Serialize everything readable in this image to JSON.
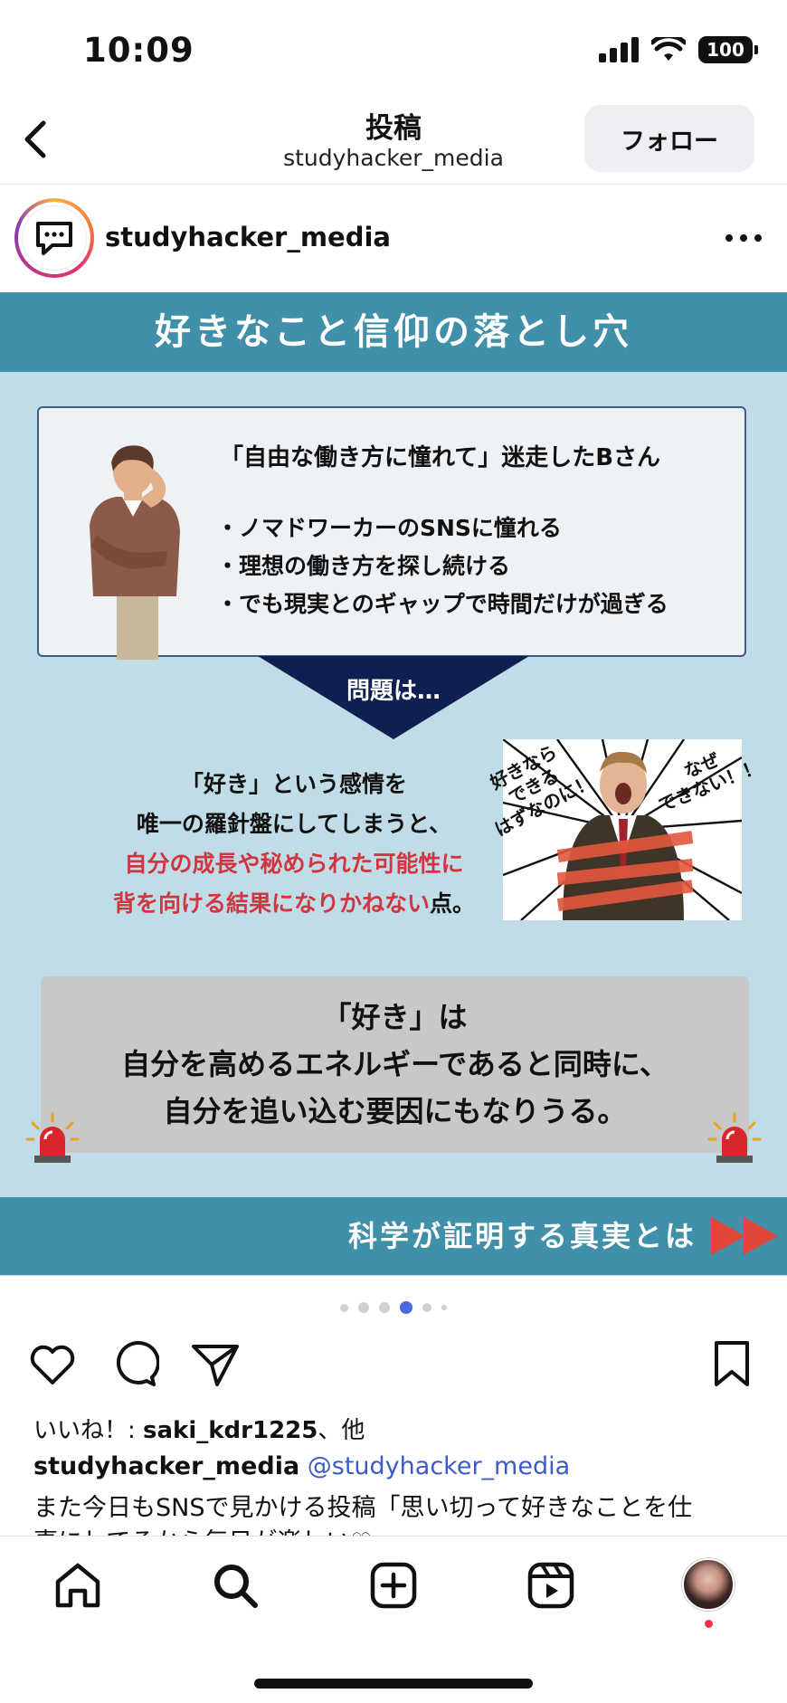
{
  "status_bar": {
    "time": "10:09",
    "battery": "100"
  },
  "nav": {
    "title": "投稿",
    "subtitle": "studyhacker_media",
    "follow_label": "フォロー"
  },
  "post": {
    "username": "studyhacker_media"
  },
  "slide": {
    "banner_title": "好きなこと信仰の落とし穴",
    "case_title": "「自由な働き方に憧れて」迷走したBさん",
    "bullets": [
      "・ノマドワーカーのSNSに憧れる",
      "・理想の働き方を探し続ける",
      "・でも現実とのギャップで時間だけが過ぎる"
    ],
    "arrow_label": "問題は…",
    "mid_line1": "「好き」という感情を",
    "mid_line2": "唯一の羅針盤にしてしまうと、",
    "mid_red1": "自分の成長や秘められた可能性に",
    "mid_red2": "背を向ける結果になりかねない",
    "mid_tail": "点。",
    "bubble1_l1": "好きなら",
    "bubble1_l2": "できる",
    "bubble1_l3": "はずなのに！",
    "bubble2_l1": "なぜ",
    "bubble2_l2": "できない！！",
    "conclusion1": "「好き」は",
    "conclusion2": "自分を高めるエネルギーであると同時に、",
    "conclusion3": "自分を追い込む要因にもなりうる。",
    "bottom_banner": "科学が証明する真実とは",
    "colors": {
      "banner": "#4190a9",
      "background": "#c0dde7",
      "accent_red": "#d03540",
      "arrow_navy": "#0f1f4f"
    }
  },
  "carousel": {
    "total": 6,
    "active": 4
  },
  "likes": {
    "prefix": "いいね！: ",
    "user": "saki_kdr1225",
    "suffix": "、他"
  },
  "caption": {
    "username": "studyhacker_media",
    "mention": "@studyhacker_media",
    "line1": "また今日もSNSで見かける投稿「思い切って好きなことを仕",
    "line2": "事にしてるから毎日が楽しい♡"
  },
  "tabbar": {
    "icons": [
      "home-icon",
      "search-icon",
      "create-icon",
      "reels-icon",
      "profile-avatar"
    ]
  }
}
